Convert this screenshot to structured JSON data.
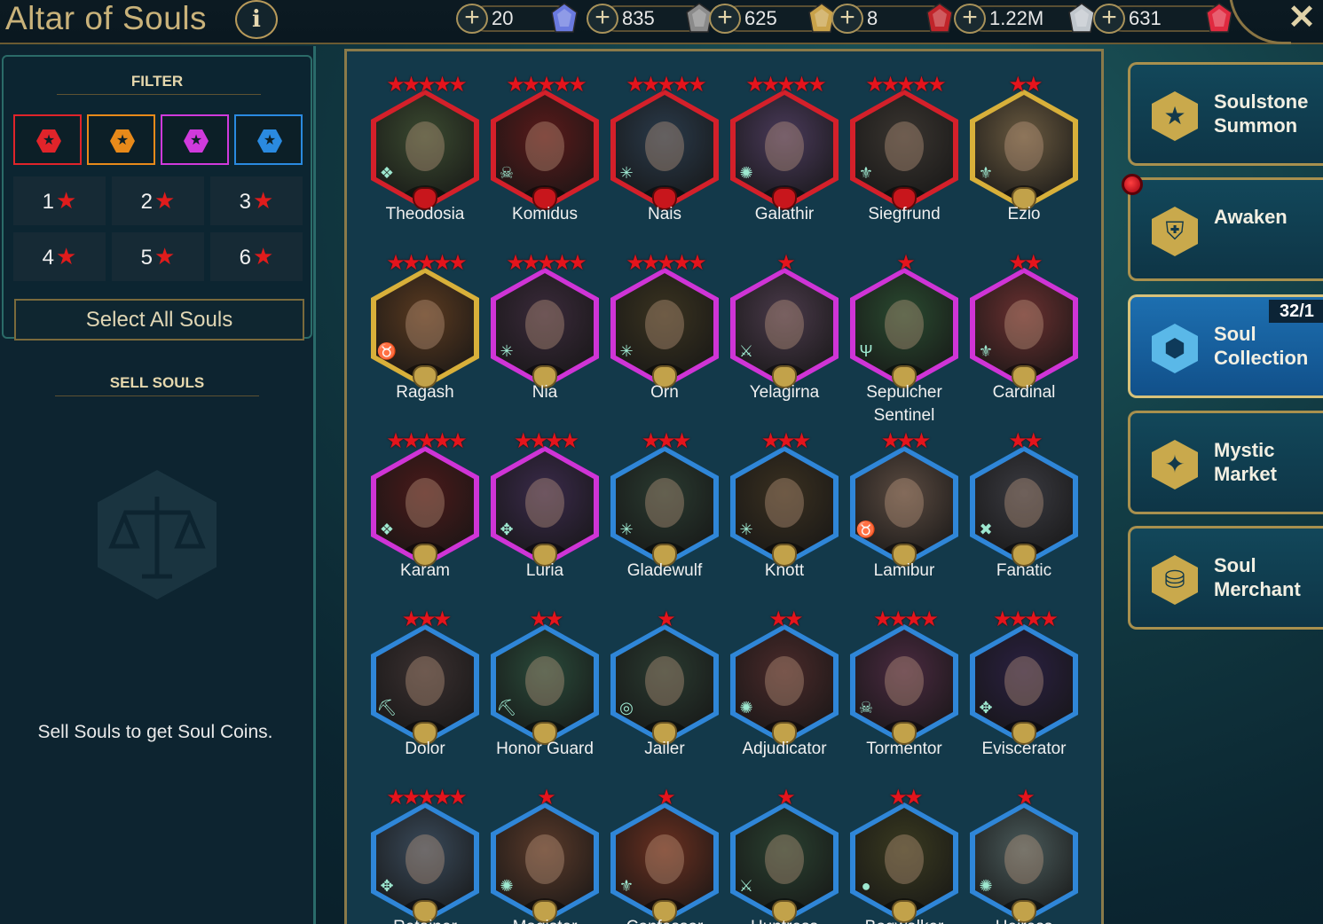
{
  "header": {
    "title": "Altar of Souls",
    "info_label": "i",
    "close_label": "✕",
    "resources": [
      {
        "name": "energy",
        "value": "20",
        "icon": "energy-crystal-icon",
        "color": "#6a7adf"
      },
      {
        "name": "arena-token",
        "value": "835",
        "icon": "arena-token-icon",
        "color": "#8a8a8a"
      },
      {
        "name": "tag-arena-token",
        "value": "625",
        "icon": "tag-arena-token-icon",
        "color": "#c9a24a"
      },
      {
        "name": "live-arena-token",
        "value": "8",
        "icon": "live-arena-token-icon",
        "color": "#c0242a"
      },
      {
        "name": "silver",
        "value": "1.22M",
        "icon": "silver-coin-icon",
        "color": "#c0c6cc"
      },
      {
        "name": "gems",
        "value": "631",
        "icon": "gem-icon",
        "color": "#e02a40"
      }
    ]
  },
  "sidebar": {
    "filter_title": "FILTER",
    "rarity_filters": [
      {
        "name": "epic-red",
        "color": "#e0242a"
      },
      {
        "name": "legendary-orange",
        "color": "#e88a1a"
      },
      {
        "name": "mythic-purple",
        "color": "#d03adc"
      },
      {
        "name": "rare-blue",
        "color": "#2a8ae0"
      }
    ],
    "star_filters": [
      "1",
      "2",
      "3",
      "4",
      "5",
      "6"
    ],
    "star_glyph": "★",
    "select_all_label": "Select All Souls",
    "sell_title": "SELL SOULS",
    "sell_text": "Sell Souls to get Soul Coins."
  },
  "souls": [
    {
      "name": "Theodosia",
      "stars": 5,
      "rarity": "#d4202a",
      "affinity_icon": "void-icon"
    },
    {
      "name": "Komidus",
      "stars": 5,
      "rarity": "#d4202a",
      "affinity_icon": "undead-icon"
    },
    {
      "name": "Nais",
      "stars": 5,
      "rarity": "#d4202a",
      "affinity_icon": "elf-icon"
    },
    {
      "name": "Galathir",
      "stars": 5,
      "rarity": "#d4202a",
      "affinity_icon": "high-elf-icon"
    },
    {
      "name": "Siegfrund",
      "stars": 5,
      "rarity": "#d4202a",
      "affinity_icon": "banner-lords-icon"
    },
    {
      "name": "Ezio",
      "stars": 2,
      "rarity": "#d8b03a",
      "affinity_icon": "banner-lords-icon"
    },
    {
      "name": "Ragash",
      "stars": 5,
      "rarity": "#d8b03a",
      "affinity_icon": "ogryn-icon"
    },
    {
      "name": "Nia",
      "stars": 5,
      "rarity": "#cf34d6",
      "affinity_icon": "elf-icon"
    },
    {
      "name": "Orn",
      "stars": 5,
      "rarity": "#cf34d6",
      "affinity_icon": "elf-icon"
    },
    {
      "name": "Yelagirna",
      "stars": 1,
      "rarity": "#cf34d6",
      "affinity_icon": "barbarian-icon"
    },
    {
      "name": "Sepulcher Sentinel",
      "stars": 1,
      "rarity": "#cf34d6",
      "affinity_icon": "sacred-order-icon"
    },
    {
      "name": "Cardinal",
      "stars": 2,
      "rarity": "#cf34d6",
      "affinity_icon": "banner-lords-icon"
    },
    {
      "name": "Karam",
      "stars": 5,
      "rarity": "#cf34d6",
      "affinity_icon": "void-icon"
    },
    {
      "name": "Luria",
      "stars": 4,
      "rarity": "#cf34d6",
      "affinity_icon": "dark-elf-icon"
    },
    {
      "name": "Gladewulf",
      "stars": 3,
      "rarity": "#2f86d8",
      "affinity_icon": "elf-icon"
    },
    {
      "name": "Knott",
      "stars": 3,
      "rarity": "#2f86d8",
      "affinity_icon": "elf-icon"
    },
    {
      "name": "Lamibur",
      "stars": 3,
      "rarity": "#2f86d8",
      "affinity_icon": "ogryn-icon"
    },
    {
      "name": "Fanatic",
      "stars": 2,
      "rarity": "#2f86d8",
      "affinity_icon": "skinwalker-icon"
    },
    {
      "name": "Dolor",
      "stars": 3,
      "rarity": "#2f86d8",
      "affinity_icon": "dwarf-icon"
    },
    {
      "name": "Honor Guard",
      "stars": 2,
      "rarity": "#2f86d8",
      "affinity_icon": "dwarf-icon"
    },
    {
      "name": "Jailer",
      "stars": 1,
      "rarity": "#2f86d8",
      "affinity_icon": "knight-revenant-icon"
    },
    {
      "name": "Adjudicator",
      "stars": 2,
      "rarity": "#2f86d8",
      "affinity_icon": "high-elf-icon"
    },
    {
      "name": "Tormentor",
      "stars": 4,
      "rarity": "#2f86d8",
      "affinity_icon": "undead-icon"
    },
    {
      "name": "Eviscerator",
      "stars": 4,
      "rarity": "#2f86d8",
      "affinity_icon": "dark-elf-icon"
    },
    {
      "name": "Retainer",
      "stars": 5,
      "rarity": "#2f86d8",
      "affinity_icon": "dark-elf-icon"
    },
    {
      "name": "Magister",
      "stars": 1,
      "rarity": "#2f86d8",
      "affinity_icon": "high-elf-icon"
    },
    {
      "name": "Confessor",
      "stars": 1,
      "rarity": "#2f86d8",
      "affinity_icon": "banner-lords-icon"
    },
    {
      "name": "Huntress",
      "stars": 1,
      "rarity": "#2f86d8",
      "affinity_icon": "barbarian-icon"
    },
    {
      "name": "Bogwalker",
      "stars": 2,
      "rarity": "#2f86d8",
      "affinity_icon": "orc-icon"
    },
    {
      "name": "Heiress",
      "stars": 1,
      "rarity": "#2f86d8",
      "affinity_icon": "high-elf-icon"
    }
  ],
  "nav": [
    {
      "label": "Soulstone Summon",
      "icon": "soulstone-icon",
      "active": false
    },
    {
      "label": "Awaken",
      "icon": "helm-icon",
      "active": false
    },
    {
      "label": "Soul Collection",
      "icon": "soul-collection-icon",
      "active": true,
      "count": "32/1"
    },
    {
      "label": "Mystic Market",
      "icon": "mystic-market-icon",
      "active": false
    },
    {
      "label": "Soul Merchant",
      "icon": "soul-merchant-icon",
      "active": false
    }
  ]
}
